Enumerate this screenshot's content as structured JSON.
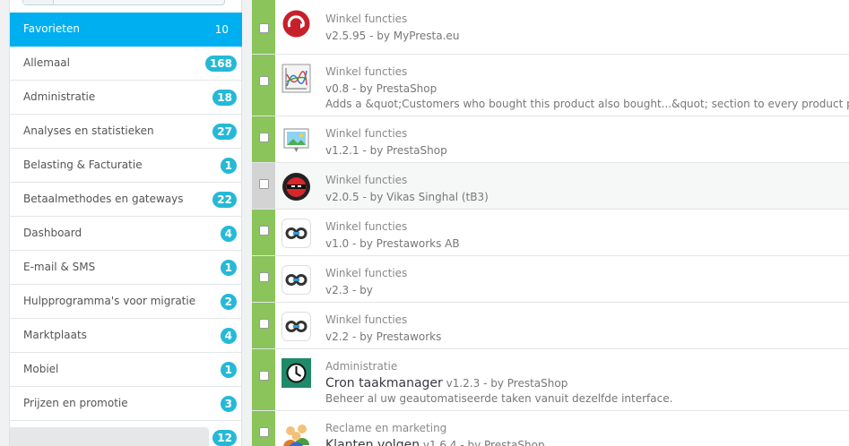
{
  "sidebar": {
    "categories": [
      {
        "label": "Favorieten",
        "count": "10",
        "active": true
      },
      {
        "label": "Allemaal",
        "count": "168"
      },
      {
        "label": "Administratie",
        "count": "18"
      },
      {
        "label": "Analyses en statistieken",
        "count": "27"
      },
      {
        "label": "Belasting & Facturatie",
        "count": "1"
      },
      {
        "label": "Betaalmethodes en gateways",
        "count": "22"
      },
      {
        "label": "Dashboard",
        "count": "4"
      },
      {
        "label": "E-mail & SMS",
        "count": "1"
      },
      {
        "label": "Hulpprogramma's voor migratie",
        "count": "2"
      },
      {
        "label": "Marktplaats",
        "count": "4"
      },
      {
        "label": "Mobiel",
        "count": "1"
      },
      {
        "label": "Prijzen en promotie",
        "count": "3"
      },
      {
        "label": "",
        "count": "12"
      }
    ]
  },
  "modules": [
    {
      "category": "Winkel functies",
      "name": "",
      "version": "v2.5.95",
      "by": " - by MyPresta.eu",
      "desc": "",
      "icon": "mypresta-logo-icon",
      "enabled": true
    },
    {
      "category": "Winkel functies",
      "name": "",
      "version": "v0.8",
      "by": " - by PrestaShop",
      "desc": "Adds a &quot;Customers who bought this product also bought...&quot; section to every product page.",
      "icon": "chart-icon",
      "enabled": true
    },
    {
      "category": "Winkel functies",
      "name": "",
      "version": "v1.2.1",
      "by": " - by PrestaShop",
      "desc": "",
      "icon": "picture-frame-icon",
      "enabled": true
    },
    {
      "category": "Winkel functies",
      "name": "",
      "version": "v2.0.5",
      "by": " - by Vikas Singhal (tB3)",
      "desc": "",
      "icon": "ninja-logo-icon",
      "enabled": false
    },
    {
      "category": "Winkel functies",
      "name": "",
      "version": "v1.0",
      "by": " - by Prestaworks AB",
      "desc": "",
      "icon": "prestaworks-logo-icon",
      "enabled": true
    },
    {
      "category": "Winkel functies",
      "name": "",
      "version": "v2.3",
      "by": " - by",
      "desc": "",
      "icon": "prestaworks-logo-icon",
      "enabled": true
    },
    {
      "category": "Winkel functies",
      "name": "",
      "version": "v2.2",
      "by": " - by Prestaworks",
      "desc": "",
      "icon": "prestaworks-logo-icon",
      "enabled": true
    },
    {
      "category": "Administratie",
      "name": "Cron taakmanager",
      "version": " v1.2.3",
      "by": " - by PrestaShop",
      "desc": "Beheer al uw geautomatiseerde taken vanuit dezelfde interface.",
      "icon": "clock-icon",
      "enabled": true
    },
    {
      "category": "Reclame en marketing",
      "name": "Klanten volgen",
      "version": " v1.6.4",
      "by": " - by PrestaShop",
      "desc": "",
      "icon": "people-icon",
      "enabled": true
    }
  ],
  "colors": {
    "active_category": "#00aff0",
    "badge": "#25b9d7",
    "enabled_status": "#8ac45a",
    "disabled_status": "#d3d3d3"
  }
}
